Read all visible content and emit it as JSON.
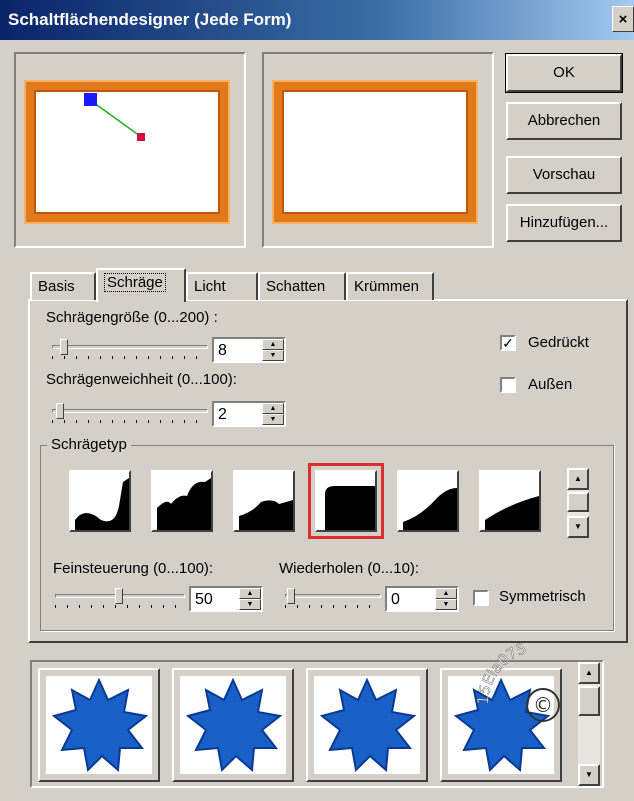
{
  "window": {
    "title": "Schaltflächendesigner (Jede Form)",
    "close_glyph": "×"
  },
  "buttons": {
    "ok": "OK",
    "cancel": "Abbrechen",
    "preview": "Vorschau",
    "add": "Hinzufügen..."
  },
  "tabs": [
    "Basis",
    "Schräge",
    "Licht",
    "Schatten",
    "Krümmen"
  ],
  "active_tab": "Schräge",
  "bevel_size": {
    "label": "Schrägengröße (0...200) :",
    "value": "8",
    "level": 0.04
  },
  "bevel_softness": {
    "label": "Schrägenweichheit (0...100):",
    "value": "2",
    "level": 0.02
  },
  "pressed": {
    "label": "Gedrückt",
    "checked": true
  },
  "outside": {
    "label": "Außen",
    "checked": false
  },
  "bevel_type": {
    "label": "Schrägetyp",
    "selected_index": 3
  },
  "fine_tuning": {
    "label": "Feinsteuerung (0...100):",
    "value": "50",
    "level": 0.5
  },
  "repeat": {
    "label": "Wiederholen (0...10):",
    "value": "0",
    "level": 0.0
  },
  "symmetric": {
    "label": "Symmetrisch",
    "checked": false
  },
  "colors": {
    "frame": "#e07a1a",
    "handle_start": "#1a1aff",
    "handle_end": "#d01040",
    "handle_line": "#20b020",
    "star": "#1860c8",
    "selection": "#d83030"
  },
  "watermark_text": "15Ela075"
}
